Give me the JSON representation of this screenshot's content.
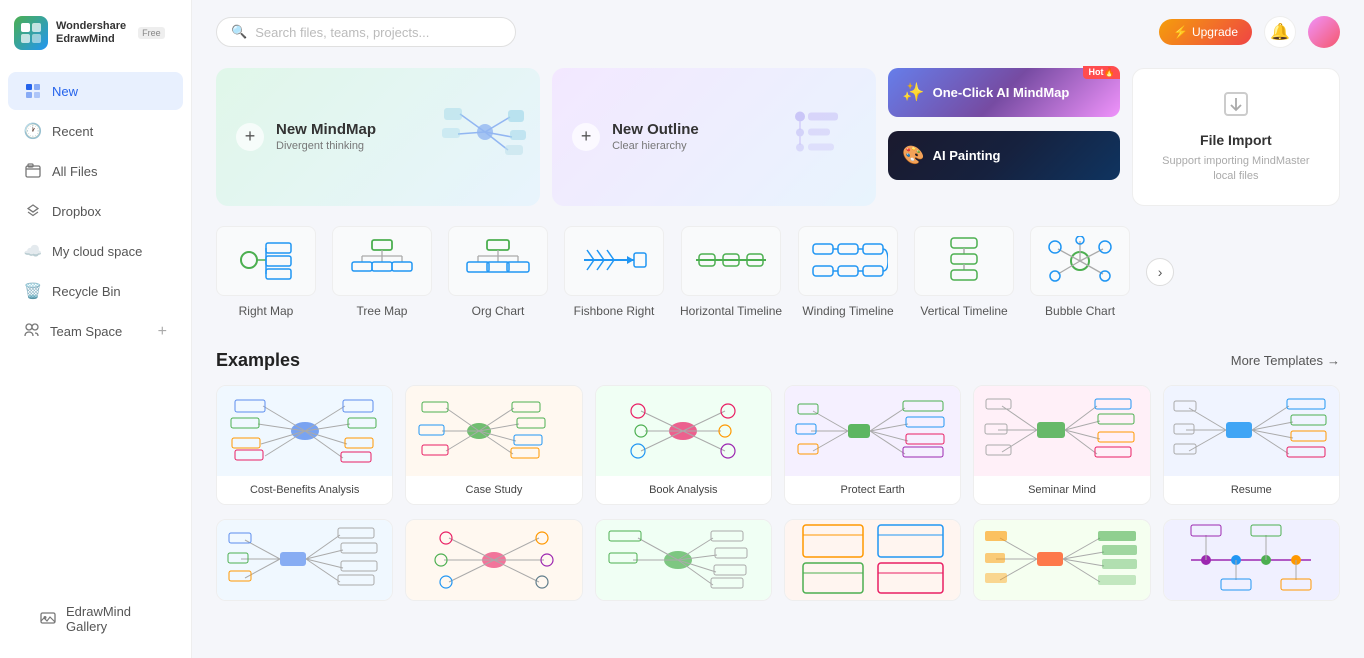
{
  "app": {
    "name": "Wondershare\nEdrawMind",
    "badge": "Free"
  },
  "sidebar": {
    "nav": [
      {
        "id": "new",
        "label": "New",
        "icon": "⊞",
        "active": true
      },
      {
        "id": "recent",
        "label": "Recent",
        "icon": "🕐",
        "active": false
      },
      {
        "id": "all-files",
        "label": "All Files",
        "icon": "📄",
        "active": false
      },
      {
        "id": "dropbox",
        "label": "Dropbox",
        "icon": "📦",
        "active": false
      },
      {
        "id": "my-cloud",
        "label": "My cloud space",
        "icon": "☁️",
        "active": false
      },
      {
        "id": "recycle",
        "label": "Recycle Bin",
        "icon": "🗑️",
        "active": false
      }
    ],
    "team_space": "Team Space",
    "gallery": "EdrawMind Gallery"
  },
  "search": {
    "placeholder": "Search files, teams, projects..."
  },
  "header": {
    "upgrade_label": "Upgrade"
  },
  "create": {
    "mindmap_title": "New MindMap",
    "mindmap_subtitle": "Divergent thinking",
    "outline_title": "New Outline",
    "outline_subtitle": "Clear hierarchy",
    "ai_mindmap": "One-Click AI MindMap",
    "ai_painting": "AI Painting",
    "file_import": "File Import",
    "file_import_sub": "Support importing MindMaster local files"
  },
  "templates": [
    {
      "id": "right-map",
      "label": "Right Map",
      "color": "#4caf50"
    },
    {
      "id": "tree-map",
      "label": "Tree Map",
      "color": "#2196F3"
    },
    {
      "id": "org-chart",
      "label": "Org Chart",
      "color": "#4caf50"
    },
    {
      "id": "fishbone-right",
      "label": "Fishbone Right",
      "color": "#2196F3"
    },
    {
      "id": "horizontal-timeline",
      "label": "Horizontal Timeline",
      "color": "#4caf50"
    },
    {
      "id": "winding-timeline",
      "label": "Winding Timeline",
      "color": "#2196F3"
    },
    {
      "id": "vertical-timeline",
      "label": "Vertical Timeline",
      "color": "#4caf50"
    },
    {
      "id": "bubble-chart",
      "label": "Bubble Chart",
      "color": "#4caf50"
    }
  ],
  "examples": {
    "title": "Examples",
    "more": "More Templates",
    "row1": [
      {
        "id": "cost-benefits",
        "label": "Cost-Benefits Analysis",
        "bg": "#f0f8ff"
      },
      {
        "id": "case-study",
        "label": "Case Study",
        "bg": "#fff8f0"
      },
      {
        "id": "book-analysis",
        "label": "Book Analysis",
        "bg": "#f0fff4"
      },
      {
        "id": "protect-earth",
        "label": "Protect Earth",
        "bg": "#f5f0ff"
      },
      {
        "id": "seminar-mind",
        "label": "Seminar Mind",
        "bg": "#fff0f8"
      },
      {
        "id": "resume",
        "label": "Resume",
        "bg": "#f0f4ff"
      }
    ],
    "row2": [
      {
        "id": "ex7",
        "label": "",
        "bg": "#f0f8ff"
      },
      {
        "id": "ex8",
        "label": "",
        "bg": "#fff8f0"
      },
      {
        "id": "ex9",
        "label": "",
        "bg": "#f0fff4"
      },
      {
        "id": "ex10",
        "label": "",
        "bg": "#fff5f0"
      },
      {
        "id": "ex11",
        "label": "",
        "bg": "#f5fff0"
      },
      {
        "id": "ex12",
        "label": "",
        "bg": "#f0f0ff"
      }
    ]
  }
}
